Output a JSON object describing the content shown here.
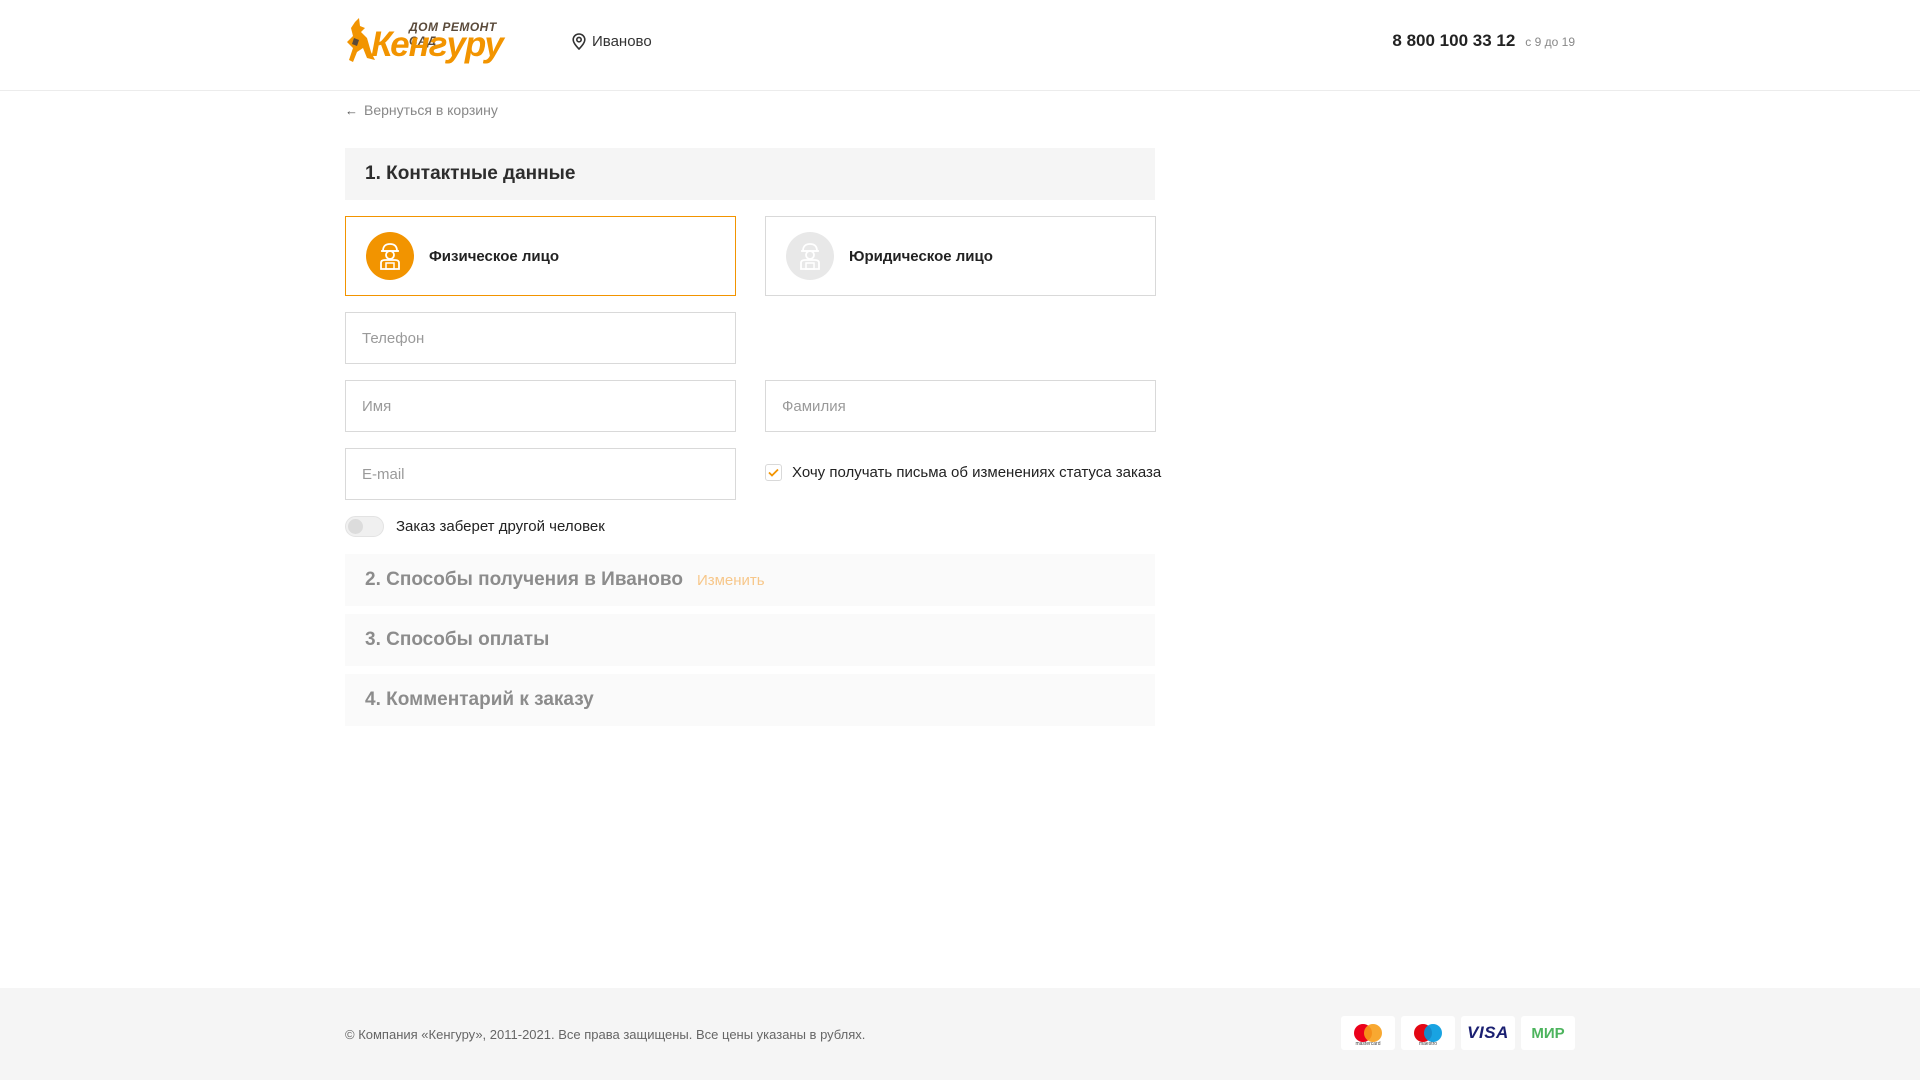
{
  "header": {
    "logo": {
      "tagline": "ДОМ РЕМОНТ САД",
      "wordmark": "Кенгуру"
    },
    "city": "Иваново",
    "phone": "8 800 100 33 12",
    "hours": "с 9 до 19"
  },
  "back_link": "Вернуться в корзину",
  "sections": {
    "contacts": "1. Контактные данные",
    "delivery": "2. Способы получения в Иваново",
    "delivery_change": "Изменить",
    "payment": "3. Способы оплаты",
    "comment": "4. Комментарий к заказу"
  },
  "person_types": {
    "individual": "Физическое лицо",
    "legal": "Юридическое лицо",
    "selected": "individual"
  },
  "fields": {
    "phone": {
      "placeholder": "Телефон",
      "value": ""
    },
    "first_name": {
      "placeholder": "Имя",
      "value": ""
    },
    "last_name": {
      "placeholder": "Фамилия",
      "value": ""
    },
    "email": {
      "placeholder": "E-mail",
      "value": ""
    }
  },
  "status_emails": {
    "label": "Хочу получать письма об изменениях статуса заказа",
    "checked": true
  },
  "other_person": {
    "label": "Заказ заберет другой человек",
    "enabled": false
  },
  "footer": {
    "copyright": "© Компания «Кенгуру», 2011-2021. Все права защищены. Все цены указаны в рублях.",
    "payment_logos": [
      {
        "icon": "mastercard-icon",
        "caption": "mastercard"
      },
      {
        "icon": "maestro-icon",
        "caption": "maestro"
      },
      {
        "icon": "visa-icon",
        "text": "VISA"
      },
      {
        "icon": "mir-icon",
        "text": "МИР"
      }
    ]
  },
  "colors": {
    "accent": "#f29400",
    "accent_light": "#f7c78a",
    "section_bg": "#f5f5f5",
    "footer_bg": "#f5f5f5"
  }
}
